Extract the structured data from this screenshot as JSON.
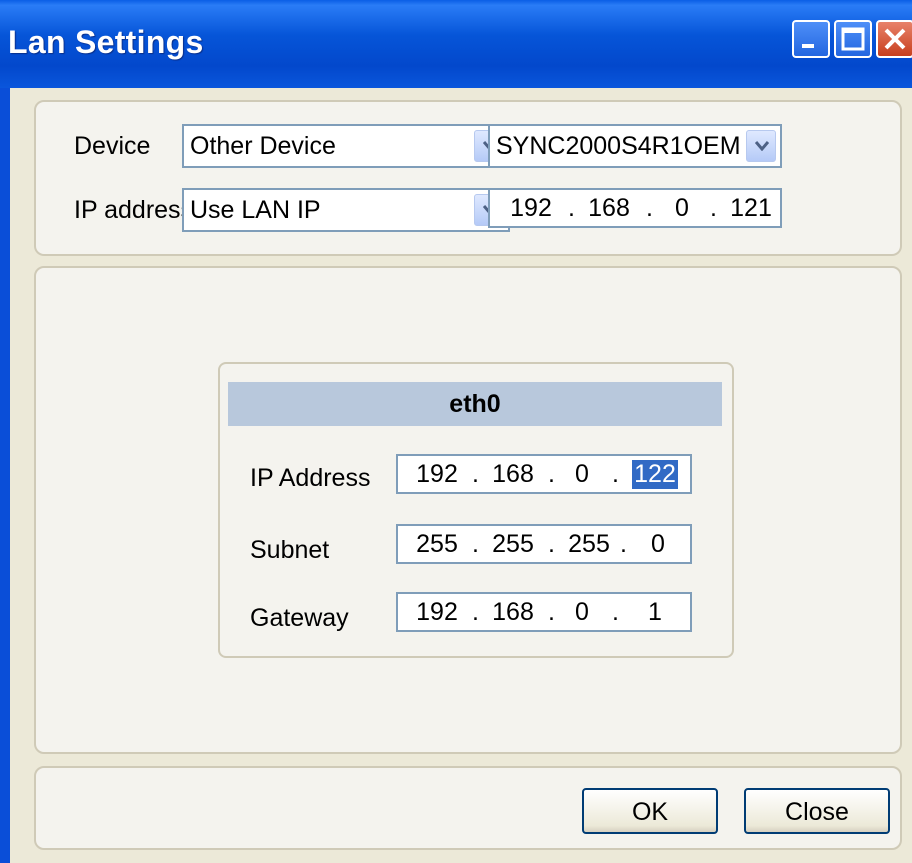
{
  "window": {
    "title": "Lan Settings"
  },
  "device_group": {
    "device_label": "Device",
    "device_type": "Other Device",
    "device_model": "SYNC2000S4R1OEM",
    "ip_label": "IP address",
    "ip_mode": "Use LAN IP",
    "ip_octets": [
      "192",
      "168",
      "0",
      "121"
    ]
  },
  "eth": {
    "title": "eth0",
    "fields": [
      {
        "label": "IP Address",
        "octets": [
          "192",
          "168",
          "0",
          "122"
        ]
      },
      {
        "label": "Subnet",
        "octets": [
          "255",
          "255",
          "255",
          "0"
        ]
      },
      {
        "label": "Gateway",
        "octets": [
          "192",
          "168",
          "0",
          "1"
        ]
      }
    ]
  },
  "buttons": {
    "ok": "OK",
    "close": "Close"
  },
  "colors": {
    "titlebar": "#0348cc",
    "selection": "#316ac5",
    "header": "#b8c8dc"
  }
}
